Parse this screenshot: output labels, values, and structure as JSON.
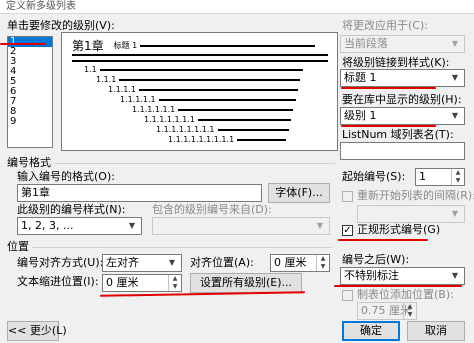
{
  "window": {
    "title": "定义新多级列表"
  },
  "levels": {
    "label": "单击要修改的级别(V):",
    "items": [
      "1",
      "2",
      "3",
      "4",
      "5",
      "6",
      "7",
      "8",
      "9"
    ],
    "selected_index": 0
  },
  "preview": {
    "heading_number": "第1章",
    "heading_style": "标题 1",
    "sub_rows": [
      "1.1",
      "1.1.1",
      "1.1.1.1",
      "1.1.1.1.1",
      "1.1.1.1.1.1",
      "1.1.1.1.1.1.1",
      "1.1.1.1.1.1.1.1",
      "1.1.1.1.1.1.1.1.1"
    ]
  },
  "apply_to": {
    "label": "将更改应用于(C):",
    "value": "当前段落"
  },
  "link_style": {
    "label": "将级别链接到样式(K):",
    "value": "标题 1"
  },
  "gallery_level": {
    "label": "要在库中显示的级别(H):",
    "value": "级别 1"
  },
  "listnum": {
    "label": "ListNum 域列表名(T):",
    "value": ""
  },
  "number_format": {
    "section_label": "编号格式",
    "format_label": "输入编号的格式(O):",
    "format_value": "第1章",
    "font_button": "字体(F)...",
    "style_label": "此级别的编号样式(N):",
    "style_value": "1, 2, 3, ...",
    "include_label": "包含的级别编号来自(D):",
    "include_value": ""
  },
  "start_at": {
    "label": "起始编号(S):",
    "value": "1"
  },
  "restart": {
    "label": "重新开始列表的间隔(R):",
    "value": ""
  },
  "legal_style": {
    "label": "正规形式编号(G)",
    "checked": true
  },
  "position": {
    "section_label": "位置",
    "align_label": "编号对齐方式(U):",
    "align_value": "左对齐",
    "aligned_at_label": "对齐位置(A):",
    "aligned_at_value": "0 厘米",
    "indent_label": "文本缩进位置(I):",
    "indent_value": "0 厘米",
    "set_all_button": "设置所有级别(E)...",
    "follow_label": "编号之后(W):",
    "follow_value": "不特别标注",
    "tab_label": "制表位添加位置(B):",
    "tab_value": "0.75 厘米"
  },
  "buttons": {
    "less": "<< 更少(L)",
    "ok": "确定",
    "cancel": "取消"
  },
  "colors": {
    "selection": "#0078d7",
    "annotation": "#e00000"
  }
}
